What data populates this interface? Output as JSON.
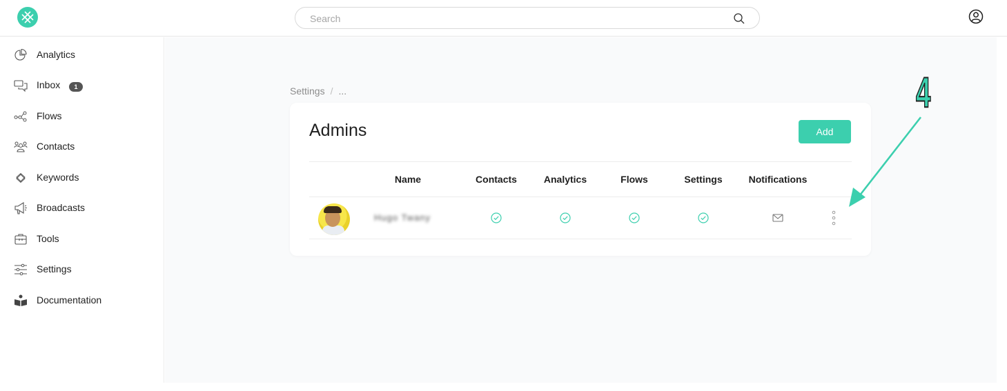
{
  "header": {
    "search_placeholder": "Search"
  },
  "sidebar": {
    "items": [
      {
        "label": "Analytics",
        "icon": "pie-chart-icon"
      },
      {
        "label": "Inbox",
        "icon": "chat-icon",
        "badge": "1"
      },
      {
        "label": "Flows",
        "icon": "flows-icon"
      },
      {
        "label": "Contacts",
        "icon": "contacts-icon"
      },
      {
        "label": "Keywords",
        "icon": "keywords-icon"
      },
      {
        "label": "Broadcasts",
        "icon": "megaphone-icon"
      },
      {
        "label": "Tools",
        "icon": "toolbox-icon"
      },
      {
        "label": "Settings",
        "icon": "sliders-icon"
      },
      {
        "label": "Documentation",
        "icon": "book-reader-icon"
      }
    ]
  },
  "breadcrumb": {
    "root": "Settings",
    "separator": "/",
    "current": "..."
  },
  "admins": {
    "title": "Admins",
    "add_label": "Add",
    "columns": [
      "Name",
      "Contacts",
      "Analytics",
      "Flows",
      "Settings",
      "Notifications"
    ],
    "rows": [
      {
        "name": "Hugo Twany",
        "contacts": "check-circle-icon",
        "analytics": "check-circle-icon",
        "flows": "check-circle-icon",
        "settings": "check-circle-icon",
        "notifications": "envelope-icon"
      }
    ]
  },
  "annotation": {
    "step": "4"
  },
  "colors": {
    "accent": "#3ccfae",
    "text": "#1f1f1f",
    "muted": "#8c8c8c"
  }
}
